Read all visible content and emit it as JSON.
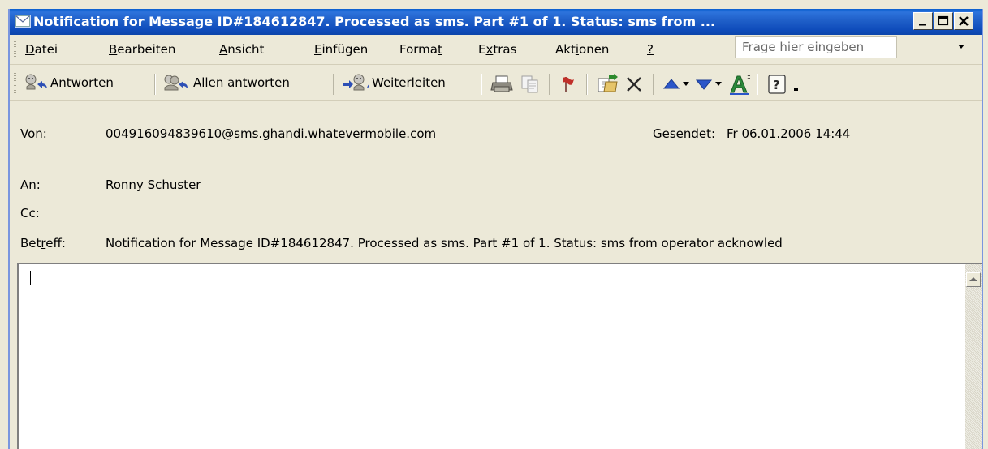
{
  "window": {
    "title": "Notification for Message ID#184612847. Processed as sms. Part #1 of 1. Status: sms from ..."
  },
  "menubar": {
    "items": [
      {
        "label": "Datei",
        "accel": "D"
      },
      {
        "label": "Bearbeiten",
        "accel": "B"
      },
      {
        "label": "Ansicht",
        "accel": "A"
      },
      {
        "label": "Einfügen",
        "accel": "E"
      },
      {
        "label": "Format",
        "accel": "t"
      },
      {
        "label": "Extras",
        "accel": "x"
      },
      {
        "label": "Aktionen",
        "accel": "i"
      },
      {
        "label": "?",
        "accel": "?"
      }
    ],
    "ask_placeholder": "Frage hier eingeben"
  },
  "toolbar": {
    "reply_label": "Antworten",
    "reply_all_label": "Allen antworten",
    "forward_label": "Weiterleiten"
  },
  "header": {
    "from_label": "Von:",
    "from_value": "004916094839610@sms.ghandi.whatevermobile.com",
    "sent_label": "Gesendet:",
    "sent_value": "Fr 06.01.2006 14:44",
    "to_label": "An:",
    "to_value": "Ronny Schuster",
    "cc_label": "Cc:",
    "cc_value": "",
    "subject_label": "Betreff:",
    "subject_value": "Notification for Message ID#184612847. Processed as sms. Part #1 of 1. Status: sms from operator acknowled"
  },
  "icons": {
    "title": "mail-envelope-icon",
    "reply": "reply-icon",
    "reply_all": "reply-all-icon",
    "forward": "forward-icon",
    "print": "print-icon",
    "copy": "copy-icon",
    "flag": "flag-icon",
    "move": "move-to-folder-icon",
    "delete": "delete-icon",
    "prev": "previous-item-icon",
    "next": "next-item-icon",
    "font_size": "font-size-icon",
    "help": "help-icon"
  },
  "colors": {
    "titlebar": "#0c4ebd",
    "face": "#ece9d8",
    "flag": "#c0302a",
    "arrow": "#2b56c9"
  }
}
